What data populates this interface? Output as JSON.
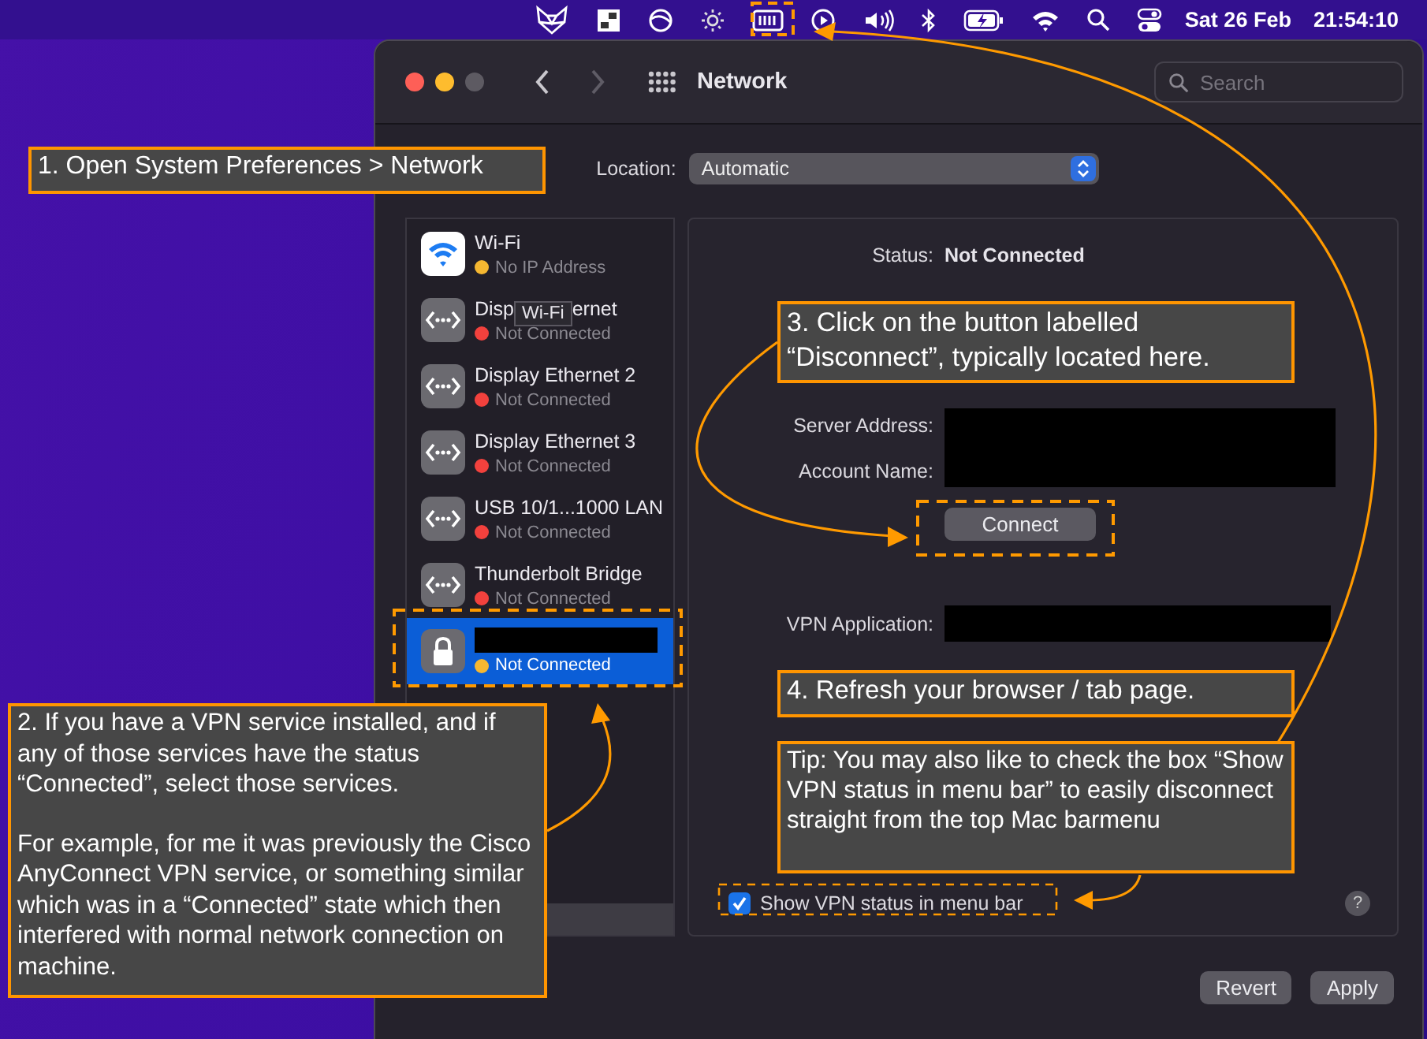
{
  "menu_bar": {
    "date": "Sat 26 Feb",
    "time": "21:54:10"
  },
  "window": {
    "title": "Network",
    "search": {
      "placeholder": "Search"
    }
  },
  "location": {
    "label": "Location:",
    "value": "Automatic"
  },
  "services": [
    {
      "kind": "wifi",
      "name": "Wi-Fi",
      "status": "No IP Address",
      "color": "#f5b731",
      "selected": false
    },
    {
      "kind": "ethernet",
      "name": "Disp",
      "tooltip": "Wi-Fi",
      "name_tail": "ernet",
      "status": "Not Connected",
      "color": "#f2413d",
      "selected": false
    },
    {
      "kind": "ethernet",
      "name": "Display Ethernet 2",
      "status": "Not Connected",
      "color": "#f2413d",
      "selected": false
    },
    {
      "kind": "ethernet",
      "name": "Display Ethernet 3",
      "status": "Not Connected",
      "color": "#f2413d",
      "selected": false
    },
    {
      "kind": "ethernet",
      "name": "USB 10/1...1000 LAN",
      "status": "Not Connected",
      "color": "#f2413d",
      "selected": false
    },
    {
      "kind": "ethernet",
      "name": "Thunderbolt Bridge",
      "status": "Not Connected",
      "color": "#f2413d",
      "selected": false
    },
    {
      "kind": "vpn",
      "status": "Not Connected",
      "color": "#f5b731",
      "selected": true
    }
  ],
  "detail": {
    "status_label": "Status:",
    "status": "Not Connected",
    "server_label": "Server Address:",
    "account_label": "Account Name:",
    "connect": "Connect",
    "vpn_app_label": "VPN Application:",
    "show_status": {
      "label": "Show VPN status in menu bar",
      "checked": true
    },
    "help": "?"
  },
  "buttons": {
    "revert": "Revert",
    "apply": "Apply"
  },
  "annotations": [
    {
      "paragraphs": [
        "1. Open System Preferences > Network"
      ]
    },
    {
      "paragraphs": [
        "2. If you have a VPN service installed, and if any of those services have the status “Connected”, select those services.",
        "For example, for me it was previously the Cisco AnyConnect VPN service, or something similar which was in a “Connected” state which then interfered with normal network connection on machine."
      ]
    },
    {
      "paragraphs": [
        "3. Click on the button labelled “Disconnect”, typically located here."
      ]
    },
    {
      "paragraphs": [
        "4. Refresh your browser / tab page."
      ]
    },
    {
      "paragraphs": [
        "Tip: You may also like to check the box “Show VPN status in menu bar” to easily disconnect straight from the top Mac barmenu"
      ]
    }
  ]
}
